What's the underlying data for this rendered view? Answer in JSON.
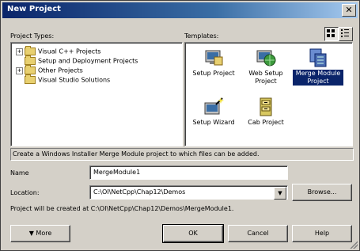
{
  "window": {
    "title": "New Project",
    "close_glyph": "✕"
  },
  "labels": {
    "project_types": "Project Types:",
    "templates": "Templates:",
    "name": "Name",
    "location": "Location:"
  },
  "project_types": [
    {
      "label": "Visual C++ Projects",
      "expandable": true
    },
    {
      "label": "Setup and Deployment Projects",
      "expandable": false
    },
    {
      "label": "Other Projects",
      "expandable": true
    },
    {
      "label": "Visual Studio Solutions",
      "expandable": false
    }
  ],
  "templates": [
    {
      "line1": "Setup Project",
      "line2": "",
      "icon": "setup-project-icon",
      "selected": false
    },
    {
      "line1": "Web Setup",
      "line2": "Project",
      "icon": "web-setup-project-icon",
      "selected": false
    },
    {
      "line1": "Merge Module",
      "line2": "Project",
      "icon": "merge-module-icon",
      "selected": true
    },
    {
      "line1": "Setup Wizard",
      "line2": "",
      "icon": "setup-wizard-icon",
      "selected": false
    },
    {
      "line1": "Cab Project",
      "line2": "",
      "icon": "cab-project-icon",
      "selected": false
    }
  ],
  "description": "Create a Windows Installer Merge Module project to which files can be added.",
  "fields": {
    "name_value": "MergeModule1",
    "location_value": "C:\\OI\\NetCpp\\Chap12\\Demos",
    "browse_label": "Browse..."
  },
  "project_path_note": "Project will be created at C:\\OI\\NetCpp\\Chap12\\Demos\\MergeModule1.",
  "buttons": {
    "more": "More",
    "more_glyph": "▼",
    "ok": "OK",
    "cancel": "Cancel",
    "help": "Help"
  },
  "colors": {
    "title_bar": "#0a246a",
    "selection": "#0a246a",
    "dialog_bg": "#d4d0c8"
  }
}
